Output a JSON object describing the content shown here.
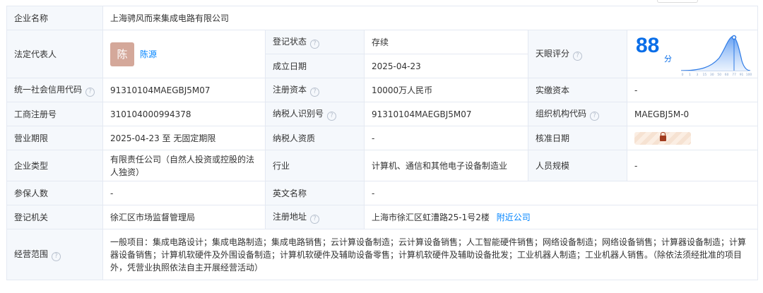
{
  "company_name": {
    "label": "企业名称",
    "value": "上海骋风而来集成电路有限公司"
  },
  "legal_rep": {
    "label": "法定代表人",
    "avatar_char": "陈",
    "name": "陈源"
  },
  "reg_status": {
    "label": "登记状态",
    "value": "存续",
    "value_color": "#2bae4c"
  },
  "established": {
    "label": "成立日期",
    "value": "2025-04-23"
  },
  "tianyan_score": {
    "label": "天眼评分",
    "value": "88",
    "unit": "分",
    "axis_ticks": [
      "0",
      "1",
      "3",
      "15",
      "30",
      "50",
      "60",
      "77",
      "91",
      "100"
    ]
  },
  "credit_code": {
    "label": "统一社会信用代码",
    "value": "91310104MAEGBJ5M07"
  },
  "reg_capital": {
    "label": "注册资本",
    "value": "10000万人民币"
  },
  "paid_capital": {
    "label": "实缴资本",
    "value": "-"
  },
  "biz_reg_no": {
    "label": "工商注册号",
    "value": "310104000994378"
  },
  "taxpayer_id": {
    "label": "纳税人识别号",
    "value": "91310104MAEGBJ5M07"
  },
  "org_code": {
    "label": "组织机构代码",
    "value": "MAEGBJ5M-0"
  },
  "biz_term": {
    "label": "营业期限",
    "value": "2025-04-23 至 无固定期限"
  },
  "taxpayer_qual": {
    "label": "纳税人资质",
    "value": "-"
  },
  "approval_date": {
    "label": "核准日期"
  },
  "company_type": {
    "label": "企业类型",
    "value": "有限责任公司（自然人投资或控股的法人独资）"
  },
  "industry": {
    "label": "行业",
    "value": "计算机、通信和其他电子设备制造业"
  },
  "staff_size": {
    "label": "人员规模",
    "value": "-"
  },
  "insured": {
    "label": "参保人数",
    "value": "-"
  },
  "english_name": {
    "label": "英文名称",
    "value": "-"
  },
  "reg_authority": {
    "label": "登记机关",
    "value": "徐汇区市场监督管理局"
  },
  "reg_address": {
    "label": "注册地址",
    "value": "上海市徐汇区虹漕路25-1号2楼",
    "link": "附近公司"
  },
  "biz_scope": {
    "label": "经营范围",
    "value": "一般项目：集成电路设计；集成电路制造；集成电路销售；云计算设备制造；云计算设备销售；人工智能硬件销售；网络设备制造；网络设备销售；计算器设备制造；计算器设备销售；计算机软硬件及外围设备制造；计算机软硬件及辅助设备零售；计算机软硬件及辅助设备批发；工业机器人制造；工业机器人销售。（除依法须经批准的项目外，凭营业执照依法自主开展经营活动）"
  },
  "colors": {
    "link": "#0084ff",
    "label_bg": "#f5f8fc",
    "border": "#e4e9f2",
    "score": "#0a6ee8"
  }
}
